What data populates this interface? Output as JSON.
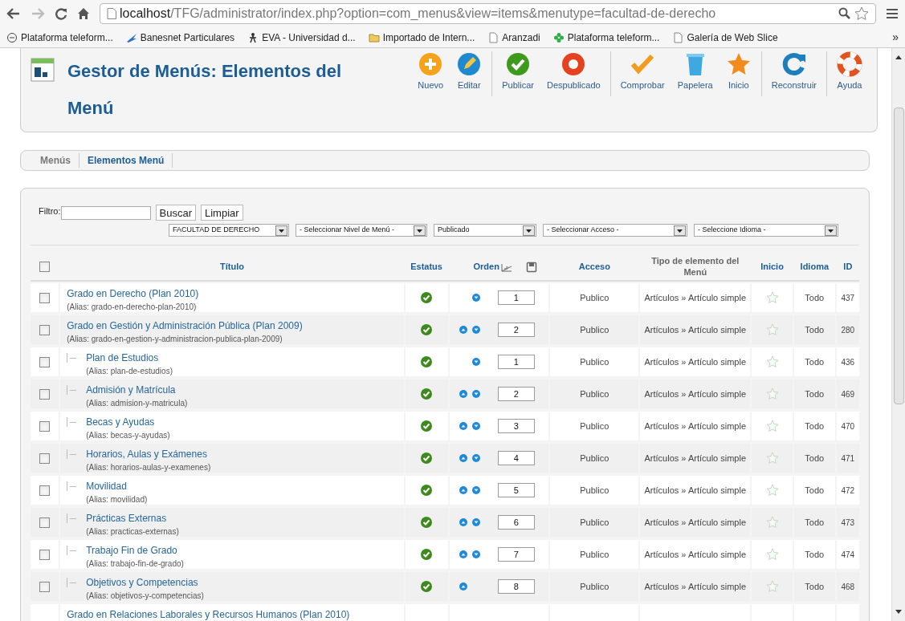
{
  "browser": {
    "url_host": "localhost",
    "url_path": "/TFG/administrator/index.php?option=com_menus&view=items&menutype=facultad-de-derecho",
    "bookmarks": [
      "Plataforma teleform...",
      "Banesnet Particulares",
      "EVA - Universidad d...",
      "Importado de Intern...",
      "Aranzadi",
      "Plataforma teleform...",
      "Galería de Web Slice"
    ],
    "overflow": "»"
  },
  "header": {
    "title": "Gestor de Menús: Elementos del Menú"
  },
  "toolbar": [
    [
      "Nuevo",
      "Editar"
    ],
    [
      "Publicar",
      "Despublicado"
    ],
    [
      "Comprobar",
      "Papelera",
      "Inicio"
    ],
    [
      "Reconstruir"
    ],
    [
      "Ayuda"
    ]
  ],
  "tabs": [
    {
      "label": "Menús",
      "selected": false
    },
    {
      "label": "Elementos Menú",
      "selected": true
    }
  ],
  "filter": {
    "label": "Filtro:",
    "buttons": [
      "Buscar",
      "Limpiar"
    ],
    "selects": [
      "FACULTAD DE DERECHO",
      "- Seleccionar Nivel de Menú -",
      "Publicado",
      "- Seleccionar Acceso -",
      "- Seleccione Idioma -"
    ]
  },
  "table": {
    "select_all_checked": false,
    "columns": [
      "Título",
      "Estatus",
      "Orden",
      "Acceso",
      "Tipo de elemento del Menú",
      "Inicio",
      "Idioma",
      "ID"
    ],
    "rows": [
      {
        "title": "Grado en Derecho (Plan 2010)",
        "alias": "(Alias: grado-en-derecho-plan-2010)",
        "checked": false,
        "published": true,
        "up": false,
        "down": true,
        "order": "1",
        "access": "Publico",
        "type": "Artículos » Artículo simple",
        "home": false,
        "language": "Todo",
        "id": "437"
      },
      {
        "title": "Grado en Gestión y Administración Pública (Plan 2009)",
        "alias": "(Alias: grado-en-gestion-y-administracion-publica-plan-2009)",
        "checked": false,
        "published": true,
        "up": true,
        "down": true,
        "order": "2",
        "access": "Publico",
        "type": "Artículos » Artículo simple",
        "home": false,
        "language": "Todo",
        "id": "280",
        "children": [
          {
            "title": "Plan de Estudios",
            "alias": "(Alias: plan-de-estudios)",
            "checked": false,
            "published": true,
            "up": false,
            "down": true,
            "order": "1",
            "access": "Publico",
            "type": "Artículos » Artículo simple",
            "home": false,
            "language": "Todo",
            "id": "436"
          },
          {
            "title": "Admisión y Matrícula",
            "alias": "(Alias: admision-y-matricula)",
            "checked": false,
            "published": true,
            "up": true,
            "down": true,
            "order": "2",
            "access": "Publico",
            "type": "Artículos » Artículo simple",
            "home": false,
            "language": "Todo",
            "id": "469"
          },
          {
            "title": "Becas y Ayudas",
            "alias": "(Alias: becas-y-ayudas)",
            "checked": false,
            "published": true,
            "up": true,
            "down": true,
            "order": "3",
            "access": "Publico",
            "type": "Artículos » Artículo simple",
            "home": false,
            "language": "Todo",
            "id": "470"
          },
          {
            "title": "Horarios, Aulas y Exámenes",
            "alias": "(Alias: horarios-aulas-y-examenes)",
            "checked": false,
            "published": true,
            "up": true,
            "down": true,
            "order": "4",
            "access": "Publico",
            "type": "Artículos » Artículo simple",
            "home": false,
            "language": "Todo",
            "id": "471"
          },
          {
            "title": "Movilidad",
            "alias": "(Alias: movilidad)",
            "checked": false,
            "published": true,
            "up": true,
            "down": true,
            "order": "5",
            "access": "Publico",
            "type": "Artículos » Artículo simple",
            "home": false,
            "language": "Todo",
            "id": "472"
          },
          {
            "title": "Prácticas Externas",
            "alias": "(Alias: practicas-externas)",
            "checked": false,
            "published": true,
            "up": true,
            "down": true,
            "order": "6",
            "access": "Publico",
            "type": "Artículos » Artículo simple",
            "home": false,
            "language": "Todo",
            "id": "473"
          },
          {
            "title": "Trabajo Fin de Grado",
            "alias": "(Alias: trabajo-fin-de-grado)",
            "checked": false,
            "published": true,
            "up": true,
            "down": true,
            "order": "7",
            "access": "Publico",
            "type": "Artículos » Artículo simple",
            "home": false,
            "language": "Todo",
            "id": "474"
          },
          {
            "title": "Objetivos y Competencias",
            "alias": "(Alias: objetivos-y-competencias)",
            "checked": false,
            "published": true,
            "up": true,
            "down": false,
            "order": "8",
            "access": "Publico",
            "type": "Artículos » Artículo simple",
            "home": false,
            "language": "Todo",
            "id": "468"
          }
        ]
      },
      {
        "title": "Grado en Relaciones Laborales y Recursos Humanos (Plan 2010)"
      }
    ]
  }
}
